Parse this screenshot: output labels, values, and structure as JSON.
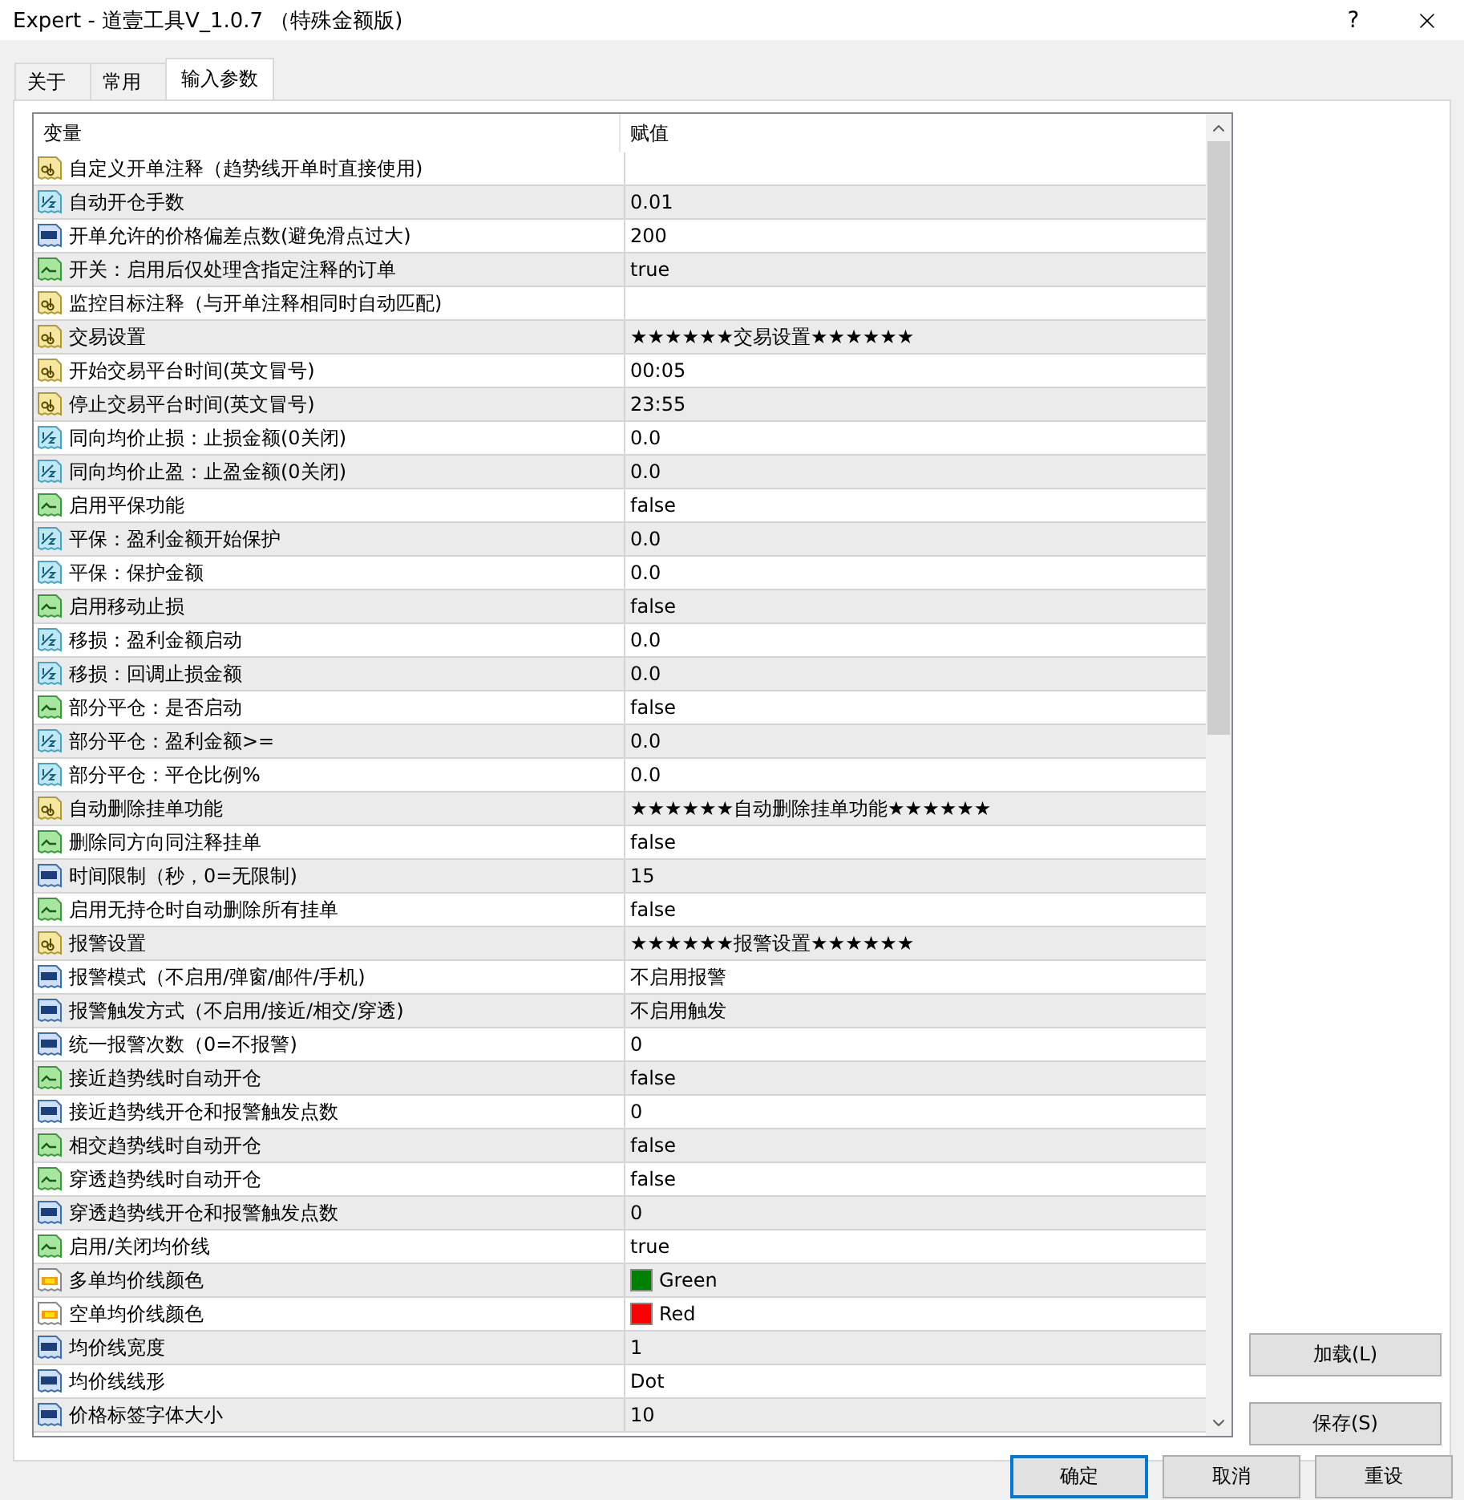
{
  "window": {
    "title": "Expert - 道壹工具V_1.0.7 （特殊金额版)",
    "help": "?"
  },
  "tabs": [
    {
      "label": "关于",
      "selected": false
    },
    {
      "label": "常用",
      "selected": false
    },
    {
      "label": "输入参数",
      "selected": true
    }
  ],
  "table": {
    "columns": [
      "变量",
      "赋值"
    ],
    "rows": [
      {
        "kind": "string",
        "name": "自定义开单注释（趋势线开单时直接使用)",
        "value": ""
      },
      {
        "kind": "double",
        "name": "自动开仓手数",
        "value": "0.01"
      },
      {
        "kind": "int",
        "name": "开单允许的价格偏差点数(避免滑点过大)",
        "value": "200"
      },
      {
        "kind": "bool",
        "name": "开关：启用后仅处理含指定注释的订单",
        "value": "true"
      },
      {
        "kind": "string",
        "name": "监控目标注释（与开单注释相同时自动匹配)",
        "value": ""
      },
      {
        "kind": "string",
        "name": "交易设置",
        "value": "★★★★★★交易设置★★★★★★"
      },
      {
        "kind": "string",
        "name": "开始交易平台时间(英文冒号)",
        "value": "00:05"
      },
      {
        "kind": "string",
        "name": "停止交易平台时间(英文冒号)",
        "value": "23:55"
      },
      {
        "kind": "double",
        "name": "同向均价止损：止损金额(0关闭)",
        "value": "0.0"
      },
      {
        "kind": "double",
        "name": "同向均价止盈：止盈金额(0关闭)",
        "value": "0.0"
      },
      {
        "kind": "bool",
        "name": "启用平保功能",
        "value": "false"
      },
      {
        "kind": "double",
        "name": "平保：盈利金额开始保护",
        "value": "0.0"
      },
      {
        "kind": "double",
        "name": "平保：保护金额",
        "value": "0.0"
      },
      {
        "kind": "bool",
        "name": "启用移动止损",
        "value": "false"
      },
      {
        "kind": "double",
        "name": "移损：盈利金额启动",
        "value": "0.0"
      },
      {
        "kind": "double",
        "name": "移损：回调止损金额",
        "value": "0.0"
      },
      {
        "kind": "bool",
        "name": "部分平仓：是否启动",
        "value": "false"
      },
      {
        "kind": "double",
        "name": "部分平仓：盈利金额>=",
        "value": "0.0"
      },
      {
        "kind": "double",
        "name": "部分平仓：平仓比例%",
        "value": "0.0"
      },
      {
        "kind": "string",
        "name": "自动删除挂单功能",
        "value": "★★★★★★自动删除挂单功能★★★★★★"
      },
      {
        "kind": "bool",
        "name": "删除同方向同注释挂单",
        "value": "false"
      },
      {
        "kind": "int",
        "name": "时间限制（秒，0=无限制)",
        "value": "15"
      },
      {
        "kind": "bool",
        "name": "启用无持仓时自动删除所有挂单",
        "value": "false"
      },
      {
        "kind": "string",
        "name": "报警设置",
        "value": "★★★★★★报警设置★★★★★★"
      },
      {
        "kind": "int",
        "name": "报警模式（不启用/弹窗/邮件/手机)",
        "value": "不启用报警"
      },
      {
        "kind": "int",
        "name": "报警触发方式（不启用/接近/相交/穿透)",
        "value": "不启用触发"
      },
      {
        "kind": "int",
        "name": "统一报警次数（0=不报警)",
        "value": "0"
      },
      {
        "kind": "bool",
        "name": "接近趋势线时自动开仓",
        "value": "false"
      },
      {
        "kind": "int",
        "name": "接近趋势线开仓和报警触发点数",
        "value": "0"
      },
      {
        "kind": "bool",
        "name": "相交趋势线时自动开仓",
        "value": "false"
      },
      {
        "kind": "bool",
        "name": "穿透趋势线时自动开仓",
        "value": "false"
      },
      {
        "kind": "int",
        "name": "穿透趋势线开仓和报警触发点数",
        "value": "0"
      },
      {
        "kind": "bool",
        "name": "启用/关闭均价线",
        "value": "true"
      },
      {
        "kind": "color",
        "name": "多单均价线颜色",
        "value": "Green",
        "color": "#008000"
      },
      {
        "kind": "color",
        "name": "空单均价线颜色",
        "value": "Red",
        "color": "#ff0000"
      },
      {
        "kind": "int",
        "name": "均价线宽度",
        "value": "1"
      },
      {
        "kind": "int",
        "name": "均价线线形",
        "value": "Dot"
      },
      {
        "kind": "int",
        "name": "价格标签字体大小",
        "value": "10"
      }
    ]
  },
  "side_buttons": [
    "加载(L)",
    "保存(S)"
  ],
  "buttons": [
    {
      "label": "确定",
      "selected": true
    },
    {
      "label": "取消",
      "selected": false
    },
    {
      "label": "重设",
      "selected": false
    }
  ]
}
